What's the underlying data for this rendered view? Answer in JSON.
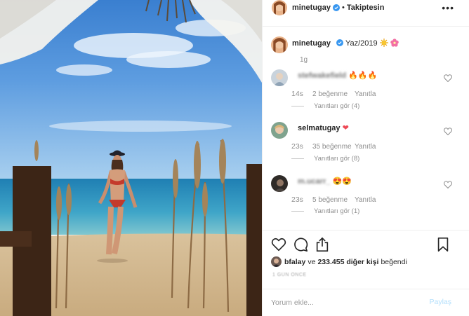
{
  "photo": {
    "alt": "beach"
  },
  "header": {
    "username": "minetugay",
    "separator": "•",
    "follow_status": "Takiptesin",
    "more_icon": "more-horizontal-icon"
  },
  "caption": {
    "username": "minetugay",
    "text": "Yaz/2019",
    "emoji_1": "sun-emoji",
    "emoji_2": "flower-emoji",
    "time": "1g"
  },
  "comments": [
    {
      "username": "stefwakefield",
      "text": "🔥🔥🔥",
      "time": "14s",
      "likes": "2 beğenme",
      "reply": "Yanıtla",
      "view_replies": "Yanıtları gör (4)",
      "blurred": true
    },
    {
      "username": "selmatugay",
      "text": "❤",
      "time": "23s",
      "likes": "35 beğenme",
      "reply": "Yanıtla",
      "view_replies": "Yanıtları gör (8)",
      "blurred": false
    },
    {
      "username": "m.ucarr_",
      "text": "😍😍",
      "time": "23s",
      "likes": "5 beğenme",
      "reply": "Yanıtla",
      "view_replies": "Yanıtları gör (1)",
      "blurred": true
    }
  ],
  "actions": {
    "like_icon": "heart-icon",
    "comment_icon": "comment-icon",
    "share_icon": "share-icon",
    "save_icon": "bookmark-icon"
  },
  "likes": {
    "username": "bfalay",
    "connector": "ve",
    "others": "233.455 diğer kişi",
    "suffix": "beğendi"
  },
  "post_time": "1 GÜN ÖNCE",
  "compose": {
    "placeholder": "Yorum ekle...",
    "post_label": "Paylaş"
  },
  "colors": {
    "accent": "#3897f0",
    "post_disabled": "#b2dffc",
    "muted": "#8e8e8e",
    "heart_red": "#ed4956"
  }
}
